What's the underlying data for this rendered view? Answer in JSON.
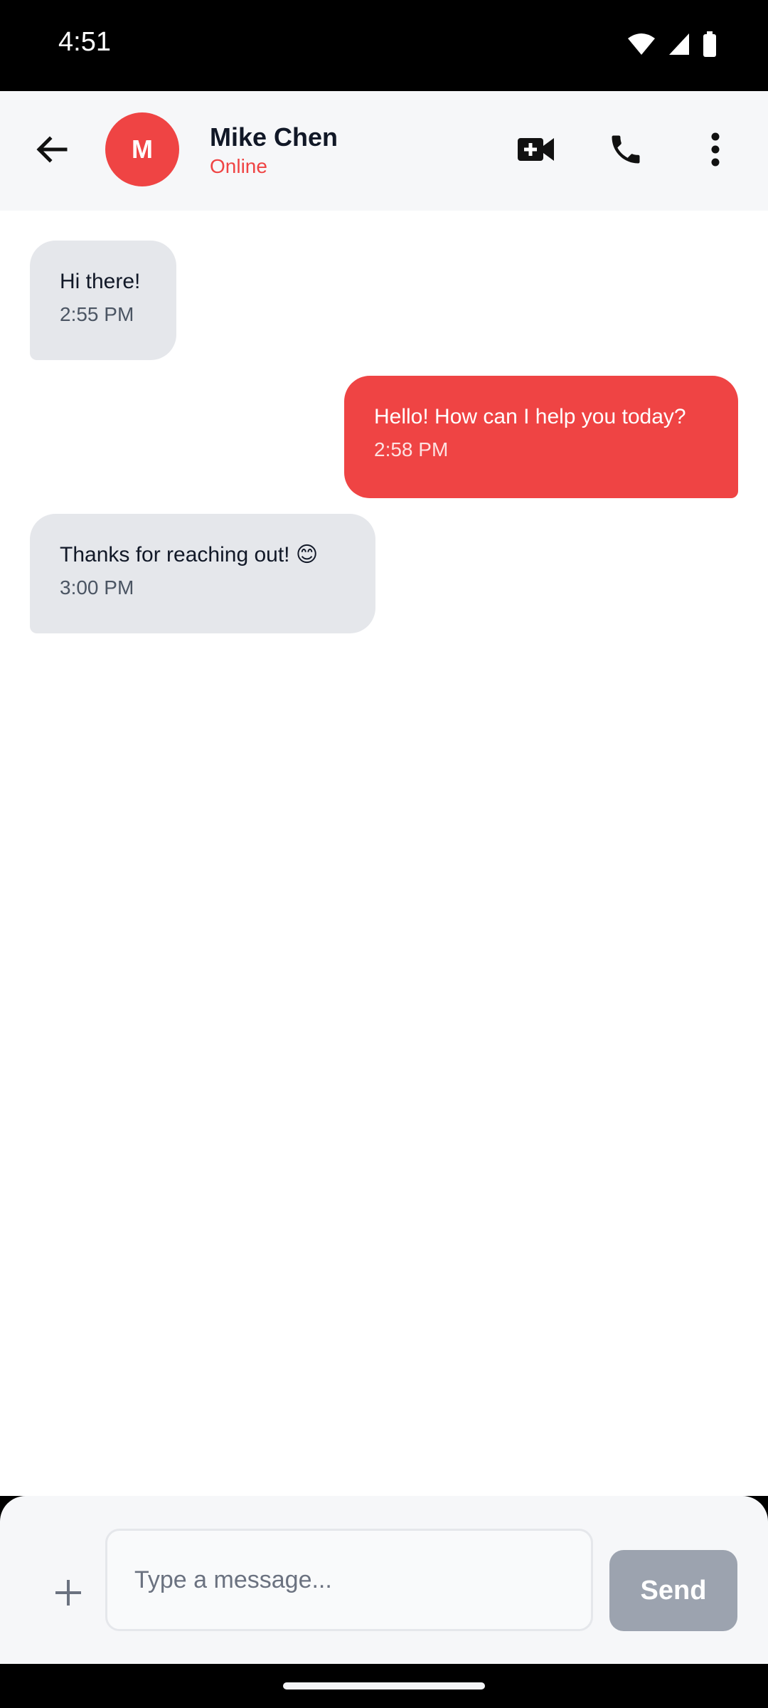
{
  "status_bar": {
    "time": "4:51",
    "icons": [
      "wifi-icon",
      "signal-icon",
      "battery-icon"
    ]
  },
  "header": {
    "back_icon": "arrow-left-icon",
    "avatar_initial": "M",
    "contact_name": "Mike Chen",
    "contact_status": "Online",
    "actions": [
      "video-call-icon",
      "phone-icon",
      "more-vert-icon"
    ]
  },
  "messages": [
    {
      "direction": "incoming",
      "text": "Hi there!",
      "time": "2:55 PM"
    },
    {
      "direction": "outgoing",
      "text": "Hello! How can I help you today?",
      "time": "2:58 PM"
    },
    {
      "direction": "incoming",
      "text": "Thanks for reaching out! 😊",
      "time": "3:00 PM"
    }
  ],
  "composer": {
    "attach_icon": "plus-icon",
    "placeholder": "Type a message...",
    "value": "",
    "send_label": "Send"
  },
  "colors": {
    "accent": "#ef4444",
    "incoming_bubble": "#e5e7eb",
    "send_disabled": "#9ca3af"
  }
}
